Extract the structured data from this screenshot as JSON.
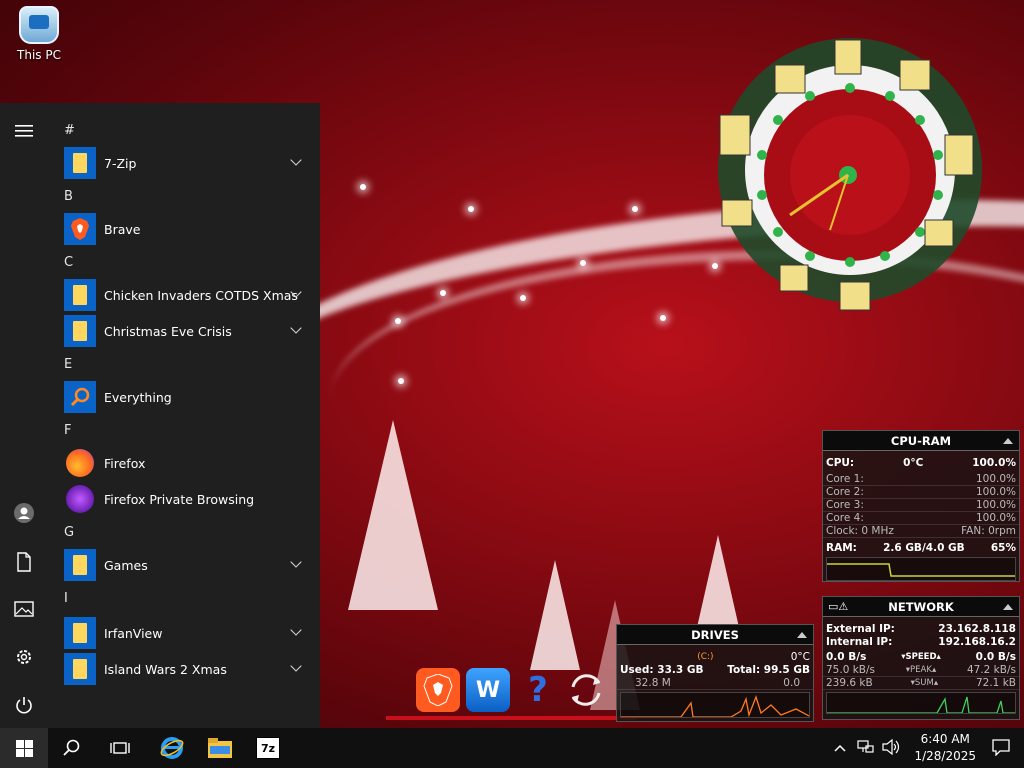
{
  "desktop": {
    "this_pc_label": "This PC"
  },
  "start_menu": {
    "groups": [
      {
        "letter": "#",
        "apps": [
          {
            "label": "7-Zip",
            "icon": "folder-icon",
            "expandable": true
          }
        ]
      },
      {
        "letter": "B",
        "apps": [
          {
            "label": "Brave",
            "icon": "brave-icon",
            "expandable": false
          }
        ]
      },
      {
        "letter": "C",
        "apps": [
          {
            "label": "Chicken Invaders COTDS Xmas",
            "icon": "folder-icon",
            "expandable": true
          },
          {
            "label": "Christmas Eve Crisis",
            "icon": "folder-icon",
            "expandable": true
          }
        ]
      },
      {
        "letter": "E",
        "apps": [
          {
            "label": "Everything",
            "icon": "magnifier-icon",
            "expandable": false
          }
        ]
      },
      {
        "letter": "F",
        "apps": [
          {
            "label": "Firefox",
            "icon": "firefox-icon",
            "expandable": false
          },
          {
            "label": "Firefox Private Browsing",
            "icon": "firefox-private-icon",
            "expandable": false
          }
        ]
      },
      {
        "letter": "G",
        "apps": [
          {
            "label": "Games",
            "icon": "folder-icon",
            "expandable": true
          }
        ]
      },
      {
        "letter": "I",
        "apps": [
          {
            "label": "IrfanView",
            "icon": "folder-icon",
            "expandable": true
          },
          {
            "label": "Island Wars 2 Xmas",
            "icon": "folder-icon",
            "expandable": true
          }
        ]
      }
    ],
    "rail": [
      "hamburger-icon",
      "user-icon",
      "documents-icon",
      "pictures-icon",
      "settings-icon",
      "power-icon"
    ]
  },
  "taskbar": {
    "pinned": [
      "search-icon",
      "task-view-icon",
      "internet-explorer-icon",
      "file-explorer-icon",
      "7zip-icon"
    ],
    "clock": {
      "time": "6:40 AM",
      "date": "1/28/2025"
    }
  },
  "widgets": {
    "cpu_ram": {
      "title": "CPU-RAM",
      "cpu_label": "CPU:",
      "cpu_temp": "0°C",
      "cpu_pct": "100.0%",
      "cores": [
        {
          "label": "Core 1:",
          "value": "100.0%"
        },
        {
          "label": "Core 2:",
          "value": "100.0%"
        },
        {
          "label": "Core 3:",
          "value": "100.0%"
        },
        {
          "label": "Core 4:",
          "value": "100.0%"
        }
      ],
      "clock": "Clock: 0 MHz",
      "fan": "FAN: 0rpm",
      "ram_label": "RAM:",
      "ram_value": "2.6 GB/4.0 GB",
      "ram_pct": "65%"
    },
    "network": {
      "title": "NETWORK",
      "external_label": "External IP:",
      "external_ip": "23.162.8.118",
      "internal_label": "Internal IP:",
      "internal_ip": "192.168.16.2",
      "rx": "0.0 B/s",
      "speed_label": "SPEED",
      "tx": "0.0 B/s",
      "rx_peak": "75.0 kB/s",
      "peak_label": "PEAK",
      "tx_peak": "47.2 kB/s",
      "rx_sum": "239.6 kB",
      "sum_label": "SUM",
      "tx_sum": "72.1 kB"
    },
    "drives": {
      "title": "DRIVES",
      "drive_letter": "C:",
      "temp": "0°C",
      "used": "Used: 33.3 GB",
      "total": "Total: 99.5 GB",
      "read": "32.8 M",
      "write": "0.0"
    }
  }
}
